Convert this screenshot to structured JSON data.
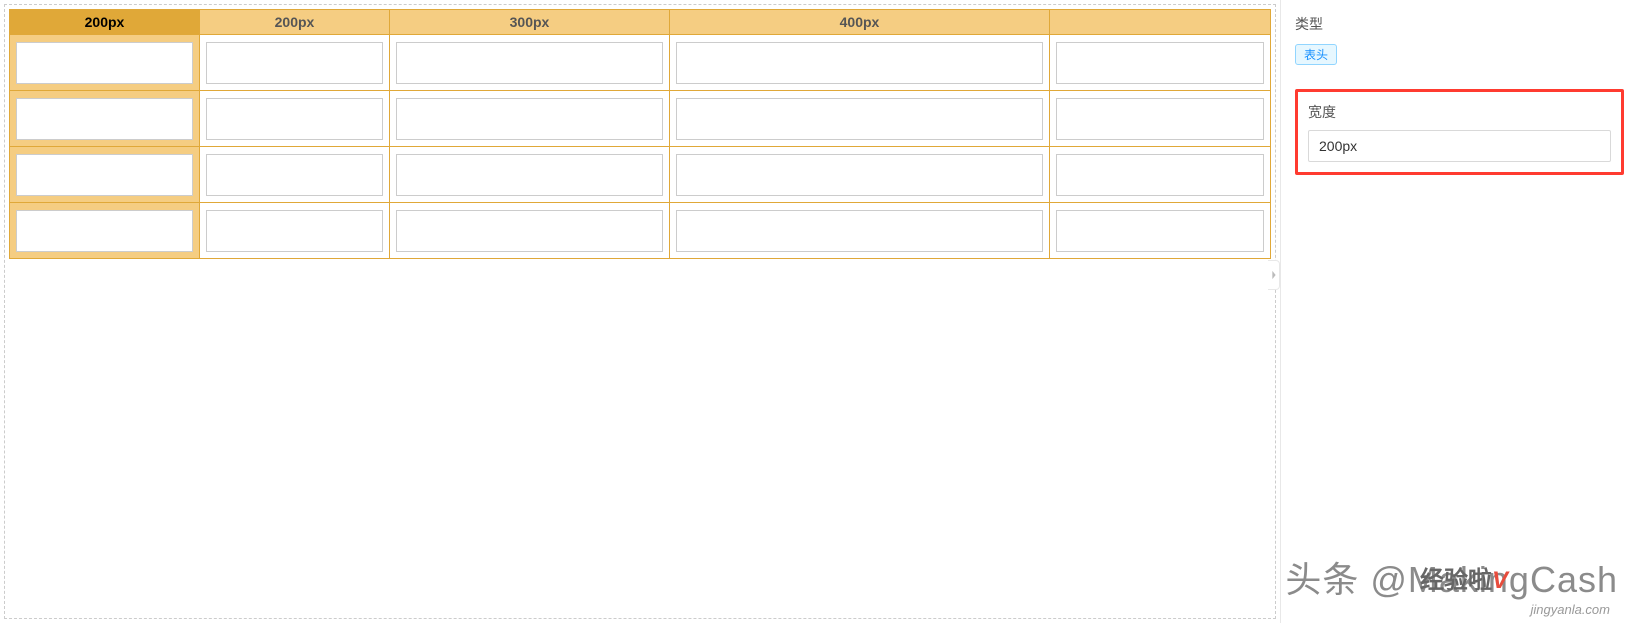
{
  "table": {
    "columns": [
      {
        "label": "200px",
        "selected": true,
        "widthClass": "col-0"
      },
      {
        "label": "200px",
        "selected": false,
        "widthClass": "col-1"
      },
      {
        "label": "300px",
        "selected": false,
        "widthClass": "col-2"
      },
      {
        "label": "400px",
        "selected": false,
        "widthClass": "col-3"
      },
      {
        "label": "",
        "selected": false,
        "widthClass": "col-4"
      }
    ],
    "rowCount": 4
  },
  "rightPanel": {
    "typeLabel": "类型",
    "typeTag": "表头",
    "widthLabel": "宽度",
    "widthValue": "200px"
  },
  "watermark": {
    "main": "头条 @MakingCash",
    "logo": "经验啦",
    "v": "V",
    "sub": "jingyanla.com"
  }
}
